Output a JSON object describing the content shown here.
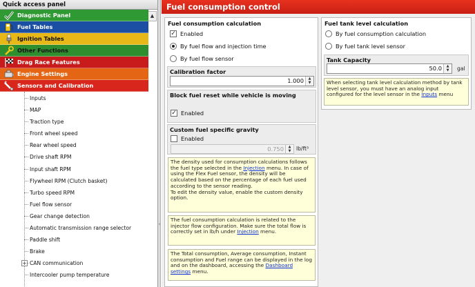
{
  "left_panel": {
    "title": "Quick access panel",
    "categories": [
      {
        "label": "Diagnostic Panel",
        "icon": "checkmark-icon"
      },
      {
        "label": "Fuel Tables",
        "icon": "fuel-pump-icon"
      },
      {
        "label": "Ignition Tables",
        "icon": "spark-plug-icon"
      },
      {
        "label": "Other Functions",
        "icon": "wrench-icon"
      },
      {
        "label": "Drag Race Features",
        "icon": "checkered-flag-icon"
      },
      {
        "label": "Engine Settings",
        "icon": "engine-icon"
      },
      {
        "label": "Sensors and Calibration",
        "icon": "sensor-icon"
      }
    ],
    "tree_items": [
      "Inputs",
      "MAP",
      "Traction type",
      "Front wheel speed",
      "Rear wheel speed",
      "Drive shaft RPM",
      "Input shaft RPM",
      "Flywheel RPM (Clutch basket)",
      "Turbo speed RPM",
      "Fuel flow sensor",
      "Gear change detection",
      "Automatic transmission range selector",
      "Paddle shift",
      "Brake",
      "CAN communication",
      "Intercooler pump temperature"
    ]
  },
  "header": {
    "title": "Fuel consumption control"
  },
  "consumption": {
    "title": "Fuel consumption calculation",
    "enabled_label": "Enabled",
    "enabled_checked": true,
    "opt_flow_injection": "By fuel flow and injection time",
    "opt_flow_sensor": "By fuel flow sensor",
    "selected_option": "flow_injection",
    "calibration_label": "Calibration factor",
    "calibration_value": "1.000",
    "block_title": "Block fuel reset while vehicle is moving",
    "block_enabled_label": "Enabled",
    "block_enabled_checked": true,
    "gravity_title": "Custom fuel specific gravity",
    "gravity_enabled_label": "Enabled",
    "gravity_value": "0.750",
    "gravity_unit": "lb/ft³",
    "note1": {
      "text_a": "The density used for consumption calculations follows the fuel type selected in the ",
      "link": "Injection",
      "text_b": " menu. In case of using the Flex Fuel sensor, the density will be calculated based on the percentage of each fuel used according to the sensor reading.",
      "text_c": "To edit the density value, enable the custom density option."
    },
    "note2": {
      "text_a": "The fuel consumption calculation is related to the injector flow configuration. Make sure the total flow is correctly set in lb/h under ",
      "link": "Injection",
      "text_b": "  menu."
    },
    "note3": {
      "text_a": "The Total consumption, Average consumption, Instant consumption and Fuel range can be displayed in the log and on the dashboard, accessing the ",
      "link": "Dashboard settings",
      "text_b": " menu."
    }
  },
  "tank": {
    "title": "Fuel tank level calculation",
    "opt_consumption": "By fuel consumption calculation",
    "opt_sensor": "By fuel tank level sensor",
    "selected_option": "none",
    "capacity_label": "Tank Capacity",
    "capacity_value": "50.0",
    "capacity_unit": "gal",
    "note": {
      "text_a": "When selecting tank level calculation method by tank level sensor, you must have an analog input configured for the level sensor in the ",
      "link": "Inputs",
      "text_b": " menu"
    }
  },
  "colors": {
    "header_red": "#d8261c",
    "note_yellow": "#ffffd9",
    "link_blue": "#0b2fd6"
  }
}
